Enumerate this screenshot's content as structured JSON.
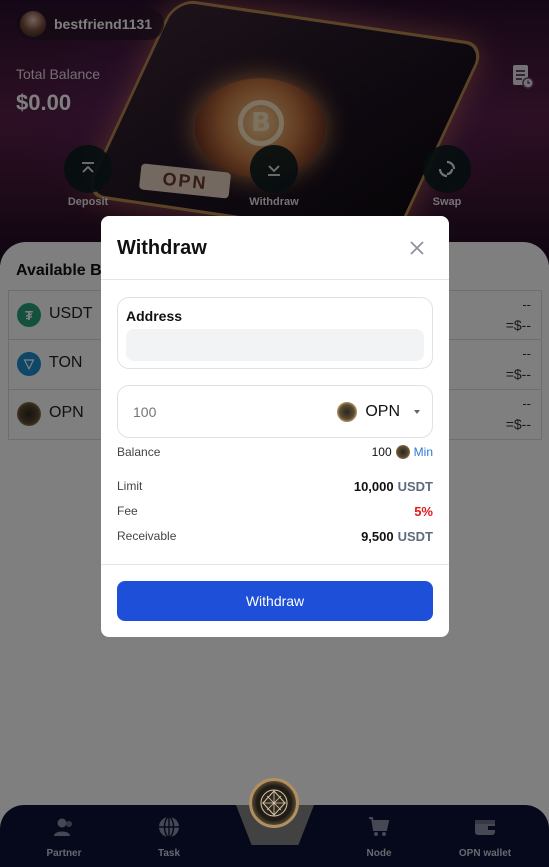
{
  "header": {
    "username": "bestfriend1131",
    "total_balance_label": "Total Balance",
    "total_balance_value": "$0.00",
    "hero_coin_symbol": "B",
    "hero_tag": "OPN"
  },
  "actions": [
    {
      "label": "Deposit",
      "icon": "deposit-icon"
    },
    {
      "label": "Withdraw",
      "icon": "withdraw-icon"
    },
    {
      "label": "Swap",
      "icon": "swap-icon"
    }
  ],
  "available": {
    "title": "Available B",
    "assets": [
      {
        "name": "USDT",
        "amount": "--",
        "usd": "=$--",
        "icon_color": "#26a17b",
        "icon_glyph": "₮"
      },
      {
        "name": "TON",
        "amount": "--",
        "usd": "=$--",
        "icon_color": "#1f8fd1",
        "icon_glyph": "▽"
      },
      {
        "name": "OPN",
        "amount": "--",
        "usd": "=$--",
        "icon_color": "#4a3f2e",
        "icon_glyph": ""
      }
    ]
  },
  "modal": {
    "title": "Withdraw",
    "address_label": "Address",
    "address_value": "",
    "amount_placeholder": "100",
    "token": "OPN",
    "balance_label": "Balance",
    "balance_value": "100",
    "min_label": "Min",
    "limit_label": "Limit",
    "limit_value": "10,000",
    "limit_unit": "USDT",
    "fee_label": "Fee",
    "fee_value": "5%",
    "receivable_label": "Receivable",
    "receivable_value": "9,500",
    "receivable_unit": "USDT",
    "submit_label": "Withdraw"
  },
  "nav": {
    "items": [
      {
        "label": "Partner",
        "icon": "partner-icon"
      },
      {
        "label": "Task",
        "icon": "globe-icon"
      },
      {
        "label": "Node",
        "icon": "cart-icon"
      },
      {
        "label": "OPN wallet",
        "icon": "wallet-icon"
      }
    ]
  },
  "colors": {
    "primary_button": "#1e4fd8",
    "fee_red": "#e01a1a",
    "min_link": "#2b7bd6",
    "nav_bg": "#0b1236"
  }
}
